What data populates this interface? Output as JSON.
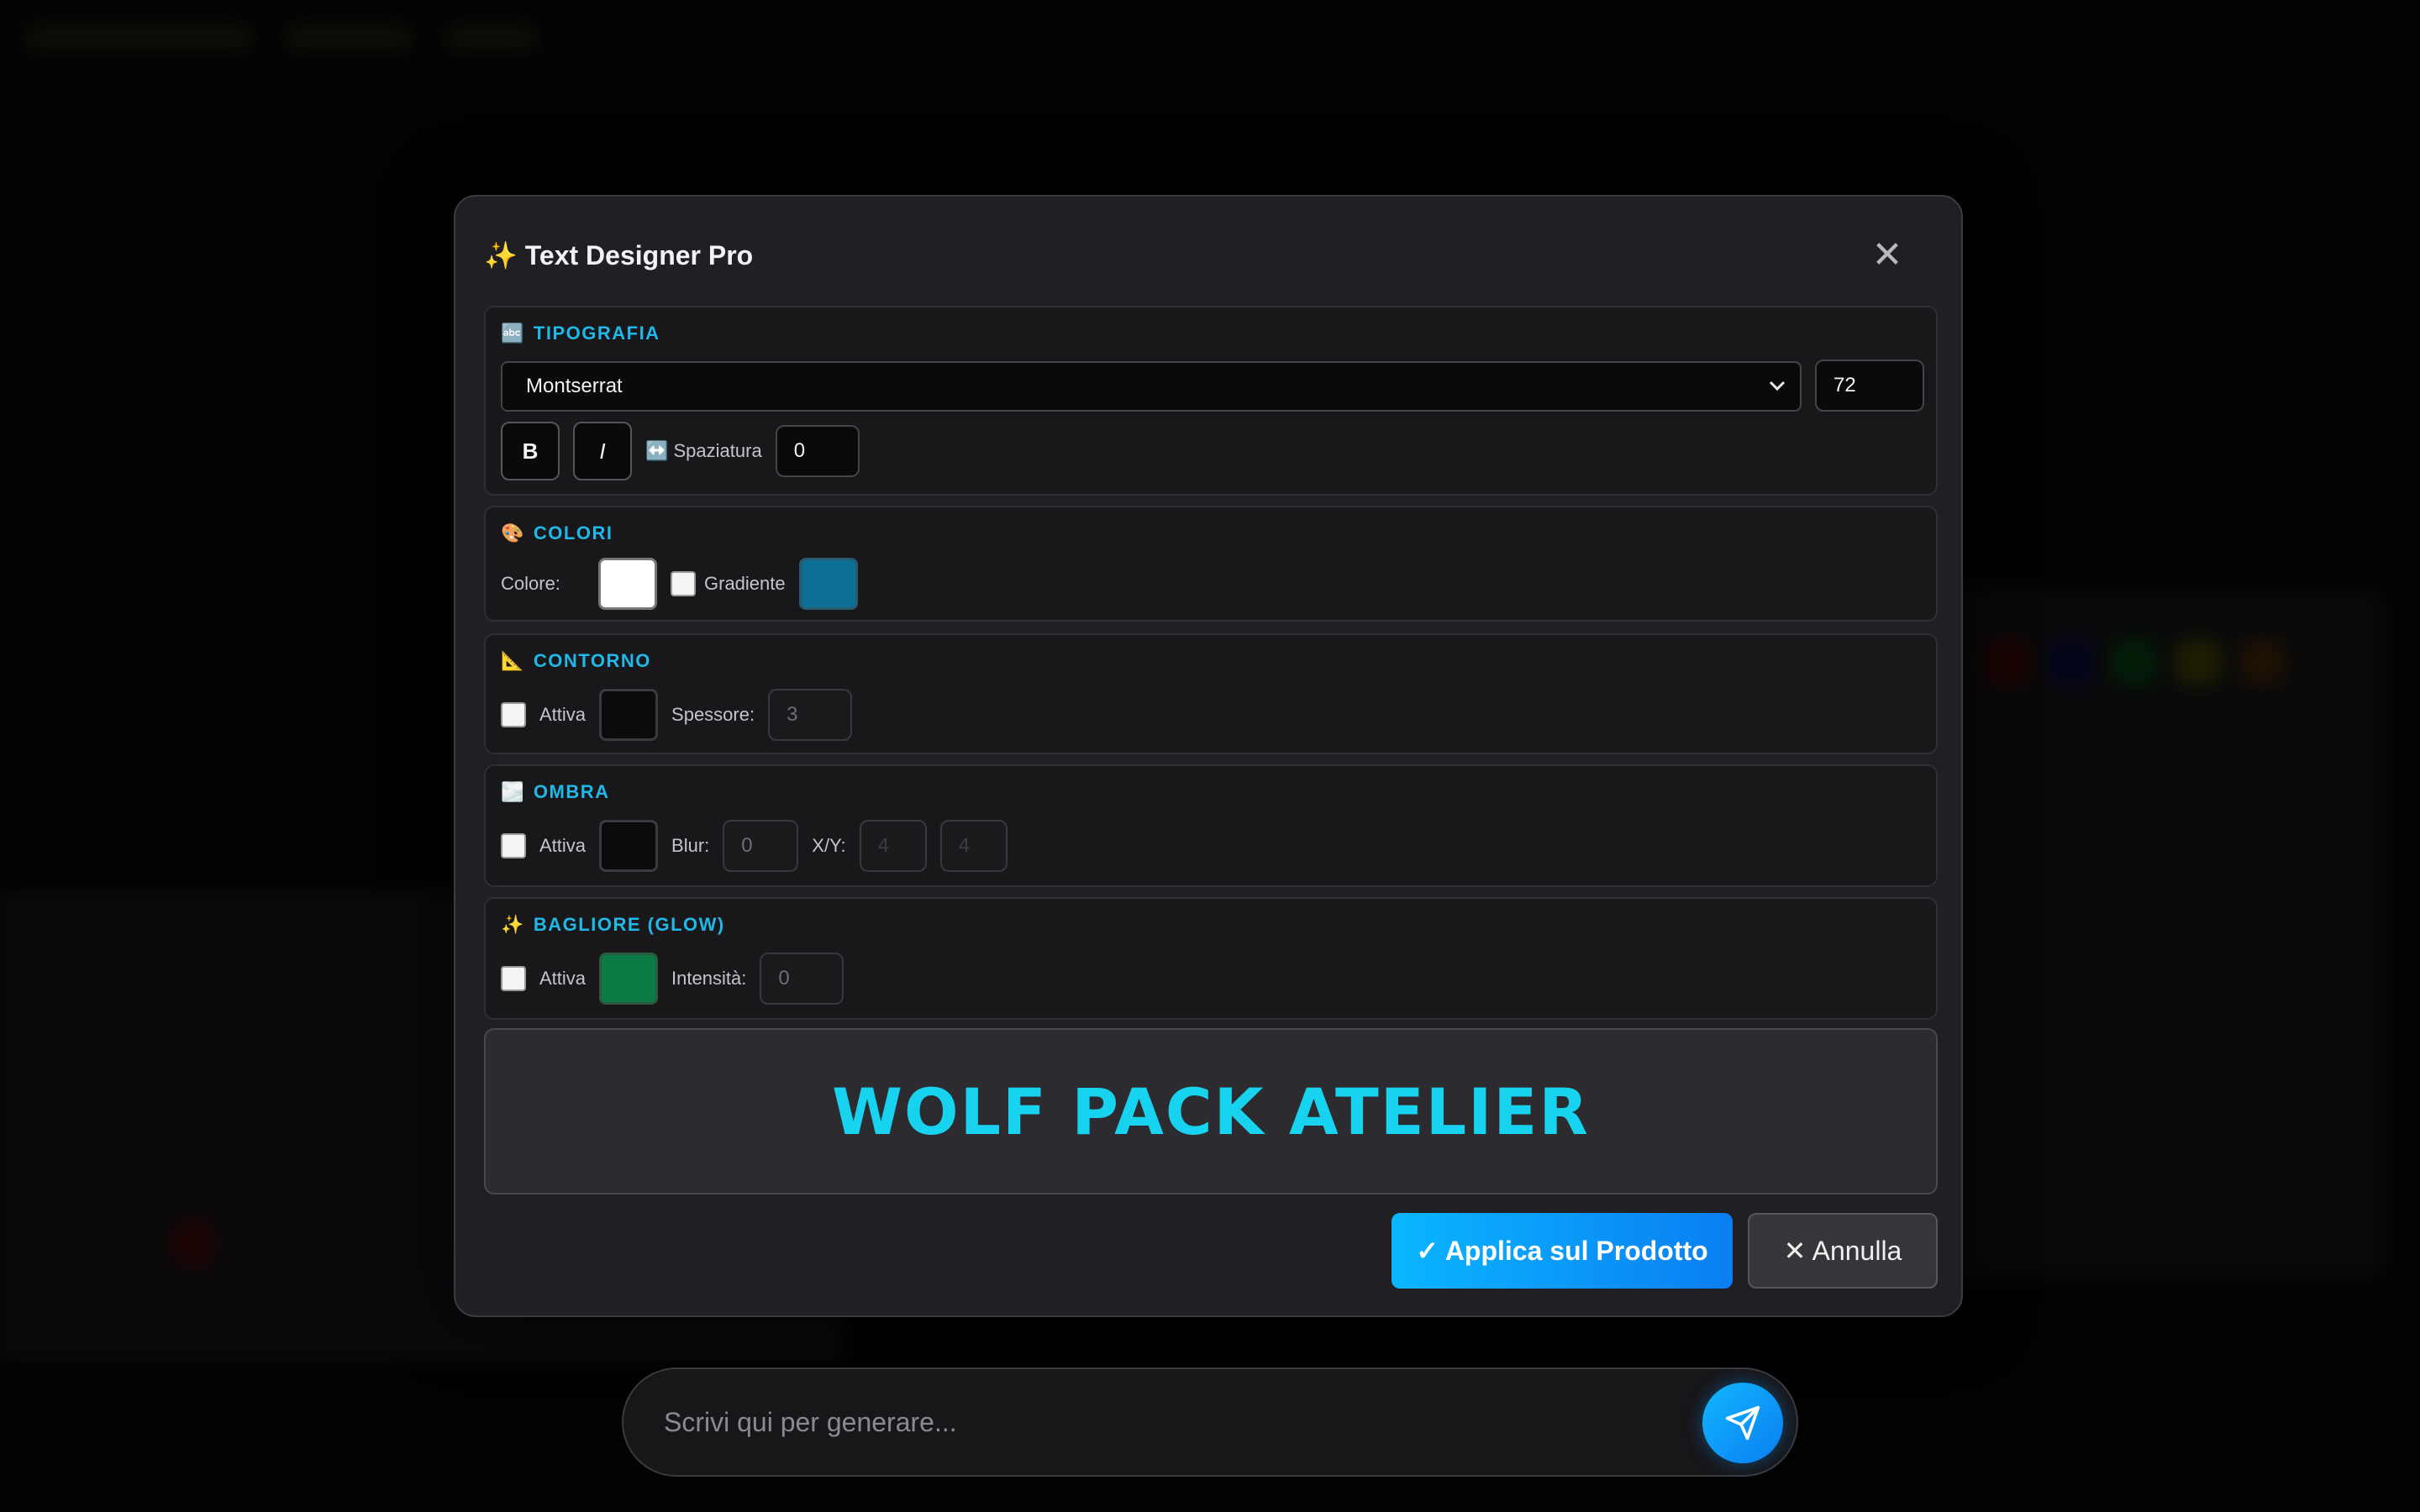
{
  "modal": {
    "title": "✨ Text Designer Pro",
    "close_label": "✕"
  },
  "typography": {
    "icon": "🔤",
    "title": "TIPOGRAFIA",
    "font_selected": "Montserrat",
    "font_size": "72",
    "bold_label": "B",
    "italic_label": "I",
    "spacing_label": "↔️ Spaziatura",
    "spacing_value": "0"
  },
  "colors": {
    "icon": "🎨",
    "title": "COLORI",
    "color_label": "Colore:",
    "color_value": "#ffffff",
    "gradient_label": "Gradiente",
    "gradient_checked": false,
    "gradient_color": "#0d6f93"
  },
  "outline": {
    "icon": "📐",
    "title": "CONTORNO",
    "active_label": "Attiva",
    "active_checked": false,
    "color_value": "#0b0b0c",
    "thickness_label": "Spessore:",
    "thickness_value": "3"
  },
  "shadow": {
    "icon": "🌫️",
    "title": "OMBRA",
    "active_label": "Attiva",
    "active_checked": false,
    "color_value": "#0b0b0c",
    "blur_label": "Blur:",
    "blur_value": "0",
    "xy_label": "X/Y:",
    "x_value": "4",
    "y_value": "4"
  },
  "glow": {
    "icon": "✨",
    "title": "BAGLIORE (GLOW)",
    "active_label": "Attiva",
    "active_checked": false,
    "color_value": "#0b7a45",
    "intensity_label": "Intensità:",
    "intensity_value": "0"
  },
  "preview": {
    "text": "WOLF PACK ATELIER",
    "color": "#18d3ef"
  },
  "actions": {
    "apply_label": "✓ Applica sul Prodotto",
    "cancel_label": "✕ Annulla"
  },
  "chat": {
    "placeholder": "Scrivi qui per generare...",
    "send_icon": "paper-plane-icon"
  }
}
